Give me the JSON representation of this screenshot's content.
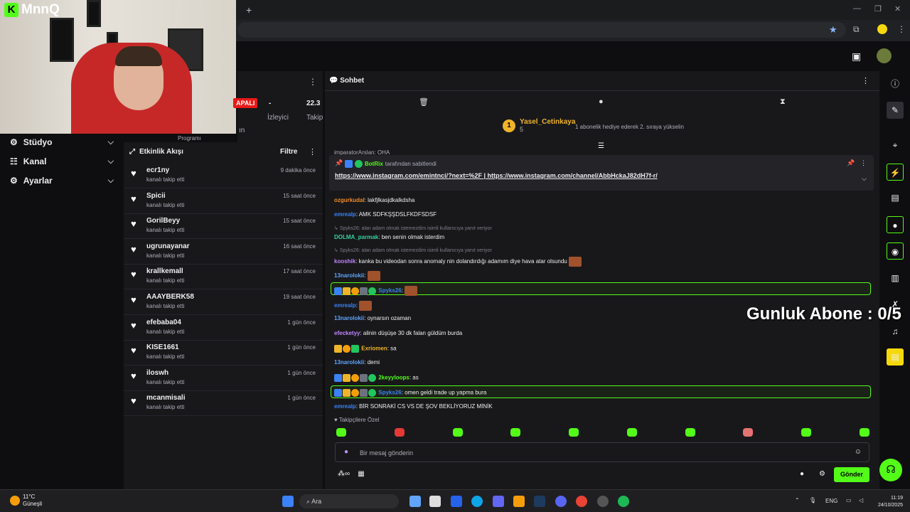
{
  "browser": {
    "new_tab": "+",
    "minimize": "—",
    "maximize": "❐",
    "close": "✕"
  },
  "logo": {
    "mark": "K",
    "text": "MnnQ"
  },
  "nav": [
    {
      "label": "Stüdyo",
      "icon": "dashboard-icon"
    },
    {
      "label": "Kanal",
      "icon": "channel-icon"
    },
    {
      "label": "Ayarlar",
      "icon": "gear-icon"
    }
  ],
  "stats": {
    "live_badge": "APALI",
    "viewers_value": "-",
    "viewers_label": "İzleyici",
    "followers_value": "22.3",
    "followers_label": "Takip",
    "extra_1": "Programı",
    "extra_2": "ın"
  },
  "activity": {
    "title": "Etkinlik Akışı",
    "filter": "Filtre",
    "rows": [
      {
        "name": "ecr1ny",
        "action": "kanalı takip etti",
        "time": "9 dakika önce"
      },
      {
        "name": "Spicii",
        "action": "kanalı takip etti",
        "time": "15 saat önce"
      },
      {
        "name": "GorilBeyy",
        "action": "kanalı takip etti",
        "time": "15 saat önce"
      },
      {
        "name": "ugrunayanar",
        "action": "kanalı takip etti",
        "time": "16 saat önce"
      },
      {
        "name": "krallkemall",
        "action": "kanalı takip etti",
        "time": "17 saat önce"
      },
      {
        "name": "AAAYBERK58",
        "action": "kanalı takip etti",
        "time": "19 saat önce"
      },
      {
        "name": "efebaba04",
        "action": "kanalı takip etti",
        "time": "1 gün önce"
      },
      {
        "name": "KISE1661",
        "action": "kanalı takip etti",
        "time": "1 gün önce"
      },
      {
        "name": "iloswh",
        "action": "kanalı takip etti",
        "time": "1 gün önce"
      },
      {
        "name": "mcanmisali",
        "action": "kanalı takip etti",
        "time": "1 gün önce"
      }
    ]
  },
  "chat": {
    "title": "Sohbet",
    "gifter": {
      "rank": "1",
      "name": "Yasel_Cetinkaya",
      "count": "5",
      "message": "1 abonelik hediye ederek 2. sıraya yükselin"
    },
    "partial_msg": "imparatorArslan: OHA",
    "pinned": {
      "user": "BotRix",
      "suffix": "tarafından sabitlendi",
      "link1": "https://www.instagram.com/emintnci/?next=%2F",
      "sep": "|",
      "link2": "https://www.instagram.com/channel/AbbHckaJ82dH7f-r/"
    },
    "messages": [
      {
        "user": "ozgurkudal",
        "color": "#f28c28",
        "text": ": lakfjlkasjdkalkdsha"
      },
      {
        "user": "emrealp",
        "color": "#3b82f6",
        "text": ": AMK SDFKŞŞDSLFKDFSDSF"
      },
      {
        "reply": "Spyks26: alan adam olmak istemezdim isimli kullanıcıya yanıt veriyor"
      },
      {
        "user": "DOLMA_parmak",
        "color": "#34d399",
        "text": ": ben senin olmak isterdim"
      },
      {
        "reply": "Spyks26: alan adam olmak istemezdim isimli kullanıcıya yanıt veriyor"
      },
      {
        "user": "kooshik",
        "color": "#c084fc",
        "text": ": kanka bu videodan sonra anomaly nin dolandırdığı adamım diye hava atar olsundu"
      },
      {
        "user": "13narolokii",
        "color": "#60a5fa",
        "text": ":"
      },
      {
        "user": "Spyks26",
        "color": "#3b82f6",
        "text": ":"
      },
      {
        "user": "emrealp",
        "color": "#3b82f6",
        "text": ":"
      },
      {
        "user": "13narolokii",
        "color": "#60a5fa",
        "text": ": oynarsın ozaman"
      },
      {
        "user": "efecketyy",
        "color": "#c084fc",
        "text": ": alinin düşüşe 30 dk falan güldüm burda"
      },
      {
        "user": "Exriomen",
        "color": "#f0b429",
        "text": ": sa"
      },
      {
        "user": "13narolokii",
        "color": "#60a5fa",
        "text": ": demi"
      },
      {
        "user": "2keyyloops",
        "color": "#53fc18",
        "text": ": as"
      },
      {
        "user": "Spyks26",
        "color": "#3b82f6",
        "text": ": omen geldi trade up yapma bura"
      },
      {
        "user": "emrealp",
        "color": "#3b82f6",
        "text": ": BİR SONRAKİ CS VS DE ŞOV BEKLİYORUZ MİNİK"
      }
    ],
    "followers_only": "♥ Takipçilere Özel",
    "placeholder": "Bir mesaj gönderin",
    "send": "Gönder"
  },
  "overlay": "Gunluk Abone : 0/5",
  "taskbar": {
    "temp": "11°C",
    "weather": "Güneşli",
    "search": "Ara",
    "lang": "ENG",
    "time": "11:19",
    "date": "24/10/2025"
  },
  "colors": {
    "accent": "#53fc18",
    "bg": "#0e0e10",
    "panel": "#18181b"
  }
}
